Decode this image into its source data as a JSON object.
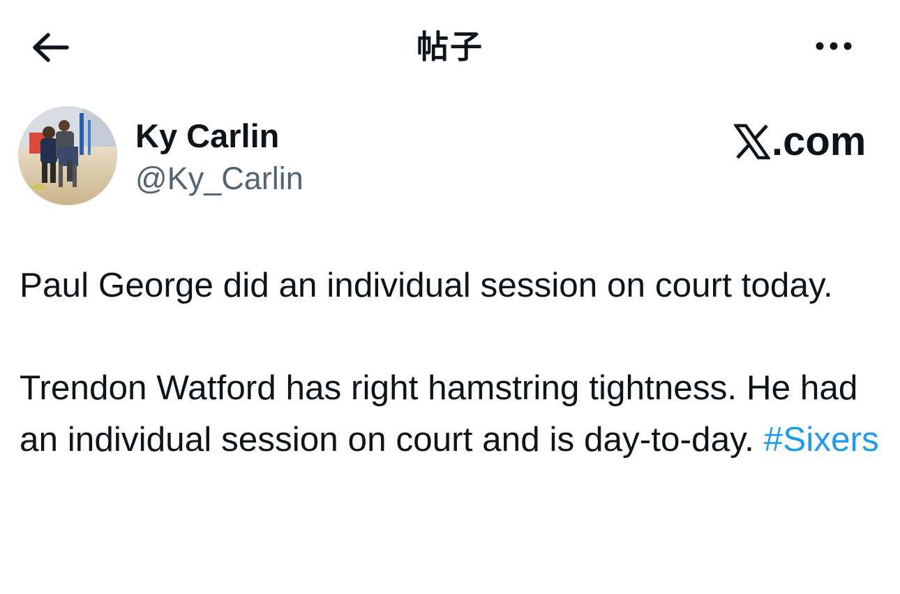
{
  "header": {
    "title": "帖子",
    "back_icon": "arrow-left-icon",
    "more_icon": "ellipsis-horizontal-icon"
  },
  "author": {
    "display_name": "Ky Carlin",
    "handle": "@Ky_Carlin",
    "avatar_icon": "profile-photo"
  },
  "source": {
    "label": ".com",
    "logo_icon": "x-logo-icon"
  },
  "tweet": {
    "paragraph_1": "Paul George did an individual session on court today.",
    "paragraph_2": "Trendon Watford has right hamstring tightness. He had an individual session on court and is day-to-day.",
    "hashtag": "#Sixers"
  },
  "colors": {
    "text_primary": "#0f1419",
    "text_secondary": "#536471",
    "link": "#1d9bf0",
    "background": "#ffffff"
  }
}
